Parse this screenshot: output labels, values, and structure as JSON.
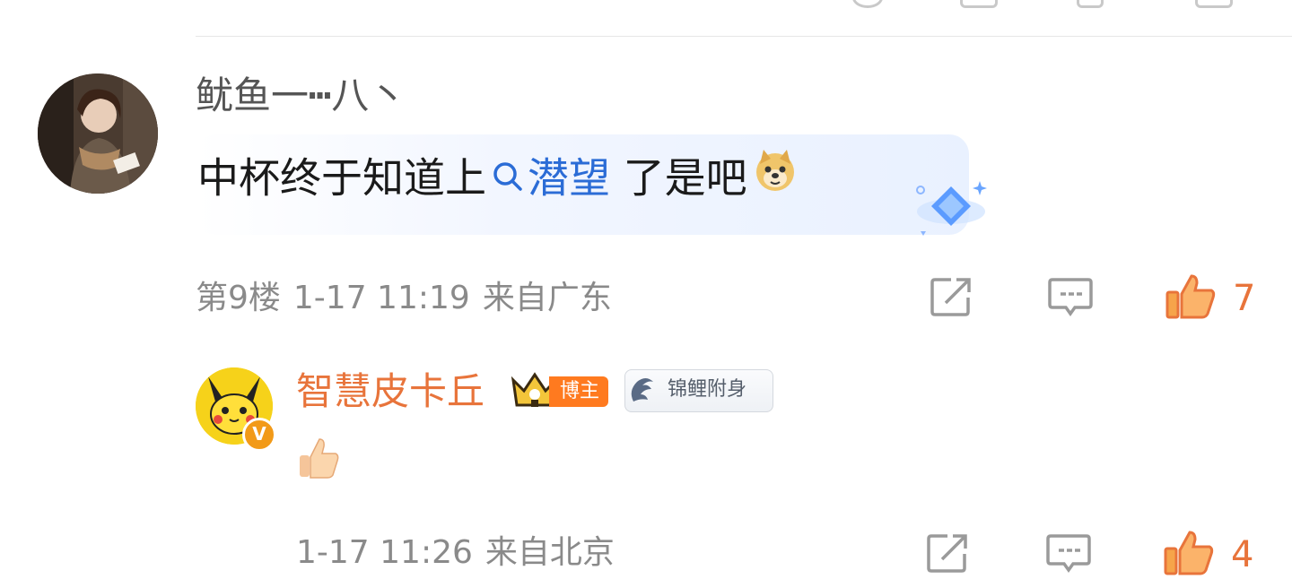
{
  "comment1": {
    "username": "鱿鱼一┅八丶",
    "text_before": "中杯终于知道上",
    "mention": "潜望",
    "text_after": " 了是吧",
    "emoji": "doge-emoji",
    "floor": "第9楼",
    "datetime": "1-17 11:19",
    "location": "来自广东",
    "like_count": "7"
  },
  "reply1": {
    "username": "智慧皮卡丘",
    "role_badge": "博主",
    "verified_badge": "V",
    "tag_label": "锦鲤附身",
    "reply_emoji": "thumbs-up-emoji",
    "datetime": "1-17 11:26",
    "location": "来自北京",
    "like_count": "4"
  },
  "colors": {
    "accent": "#e8743b",
    "link": "#2b6cd6",
    "meta_text": "#8a8a8a",
    "icon_gray": "#9a9a9a"
  }
}
